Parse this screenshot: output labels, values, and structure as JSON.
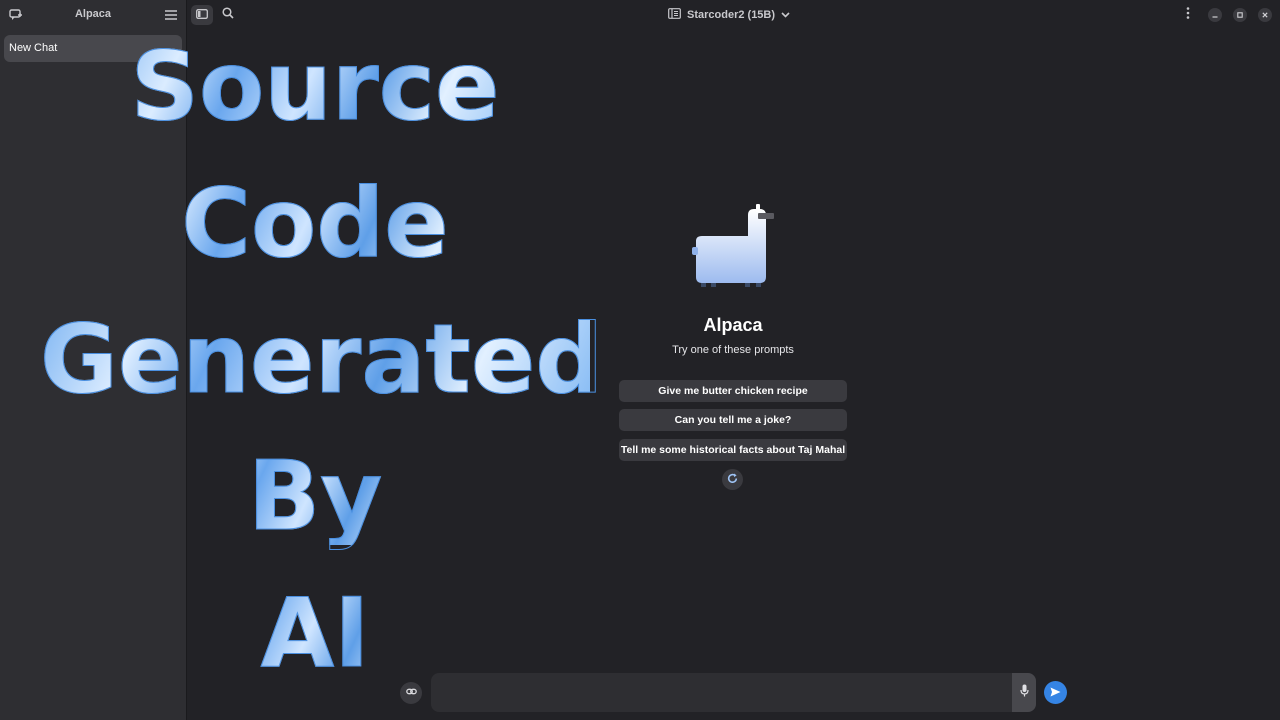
{
  "sidebar": {
    "title": "Alpaca",
    "chats": [
      {
        "label": "New Chat",
        "selected": true
      }
    ]
  },
  "header": {
    "model_name": "Starcoder2 (15B)"
  },
  "welcome": {
    "title": "Alpaca",
    "subtitle": "Try one of these prompts",
    "prompts": [
      "Give me butter chicken recipe",
      "Can you tell me a joke?",
      "Tell me some historical facts about Taj Mahal"
    ]
  },
  "input": {
    "value": "",
    "placeholder": ""
  },
  "overlay": {
    "lines": [
      "Source",
      "Code",
      "Generated",
      "By",
      "AI"
    ]
  },
  "colors": {
    "background": "#222226",
    "sidebar": "#2e2e32",
    "accent": "#3584e4",
    "overlay_text": "#a8cdf4"
  },
  "icons": {
    "new_chat": "chat-add-icon",
    "menu": "hamburger-menu-icon",
    "sidebar_toggle": "sidebar-toggle-icon",
    "search": "search-icon",
    "model": "model-manager-icon",
    "model_dropdown": "chevron-down-icon",
    "kebab": "vertical-dots-icon",
    "minimize": "minimize-icon",
    "maximize": "maximize-icon",
    "close": "close-icon",
    "refresh": "refresh-icon",
    "attach": "attachment-icon",
    "mic": "microphone-icon",
    "send": "send-icon",
    "logo": "alpaca-logo-icon"
  }
}
